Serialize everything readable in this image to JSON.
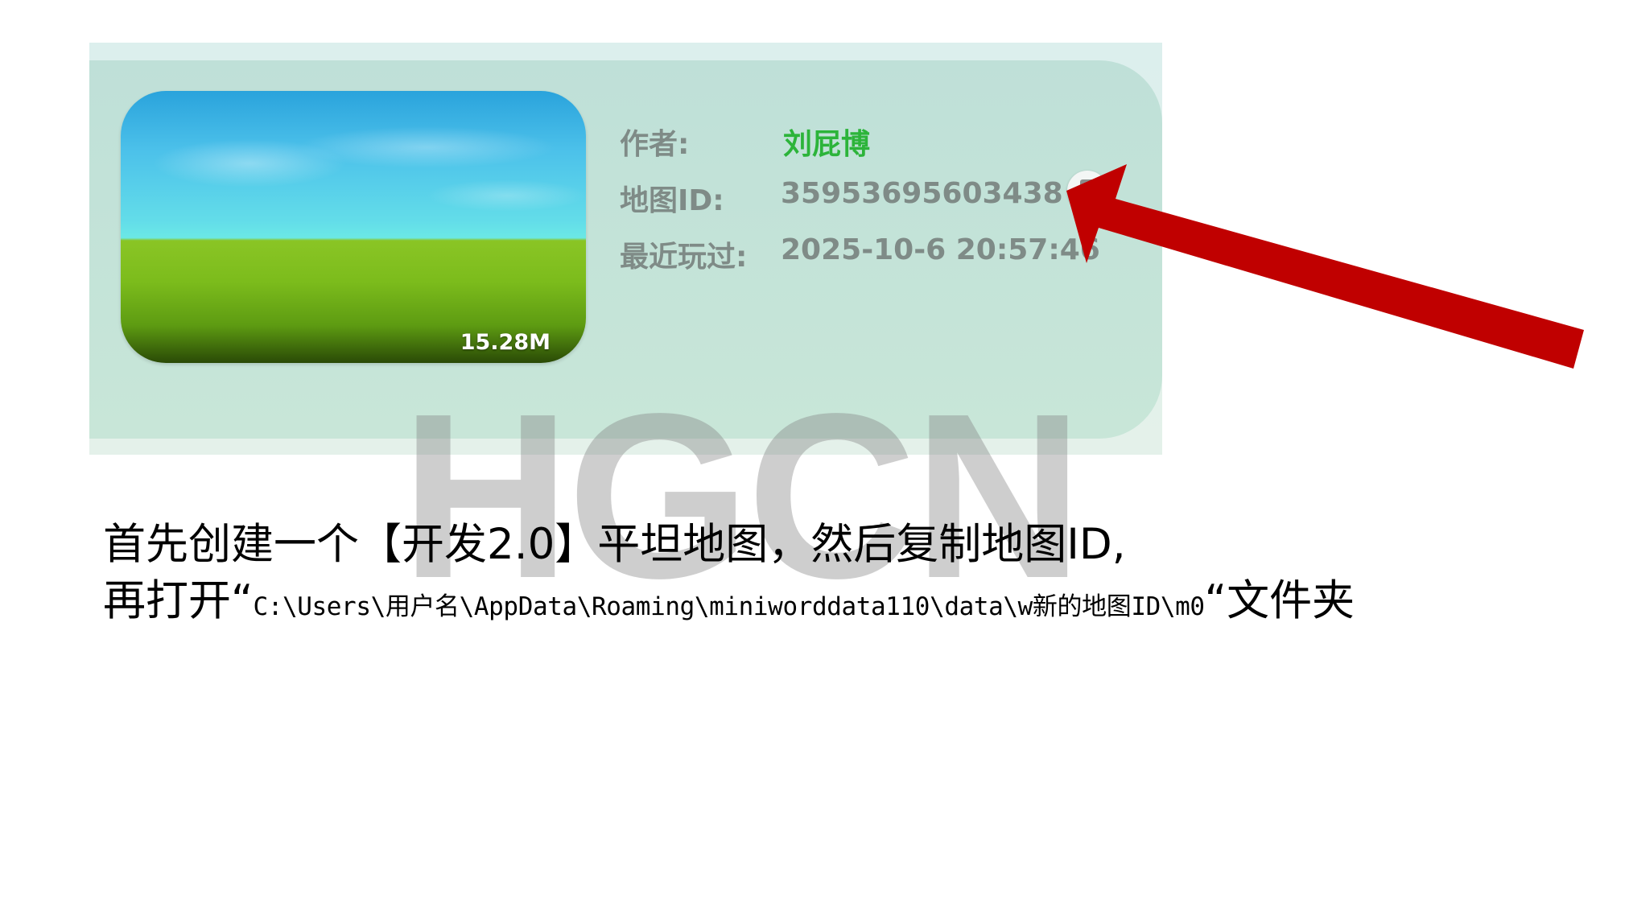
{
  "map_card": {
    "thumbnail_size": "15.28M",
    "author_label": "作者:",
    "author_value": "刘屁博",
    "map_id_label": "地图ID:",
    "map_id_value": "35953695603438",
    "last_played_label": "最近玩过:",
    "last_played_value": "2025-10-6  20:57:46"
  },
  "watermark": "HGCN",
  "instructions": {
    "line1": "首先创建一个【开发2.0】平坦地图，然后复制地图ID,",
    "line2_prefix": "再打开“",
    "line2_path": "C:\\Users\\用户名\\AppData\\Roaming\\miniworddata110\\data\\w新的地图ID\\m0",
    "line2_suffix": "“文件夹"
  },
  "colors": {
    "author_green": "#2cb43a",
    "arrow_red": "#c00000",
    "info_gray": "#7f8b87"
  },
  "icons": {
    "copy": "copy-icon",
    "arrow": "red-arrow"
  }
}
